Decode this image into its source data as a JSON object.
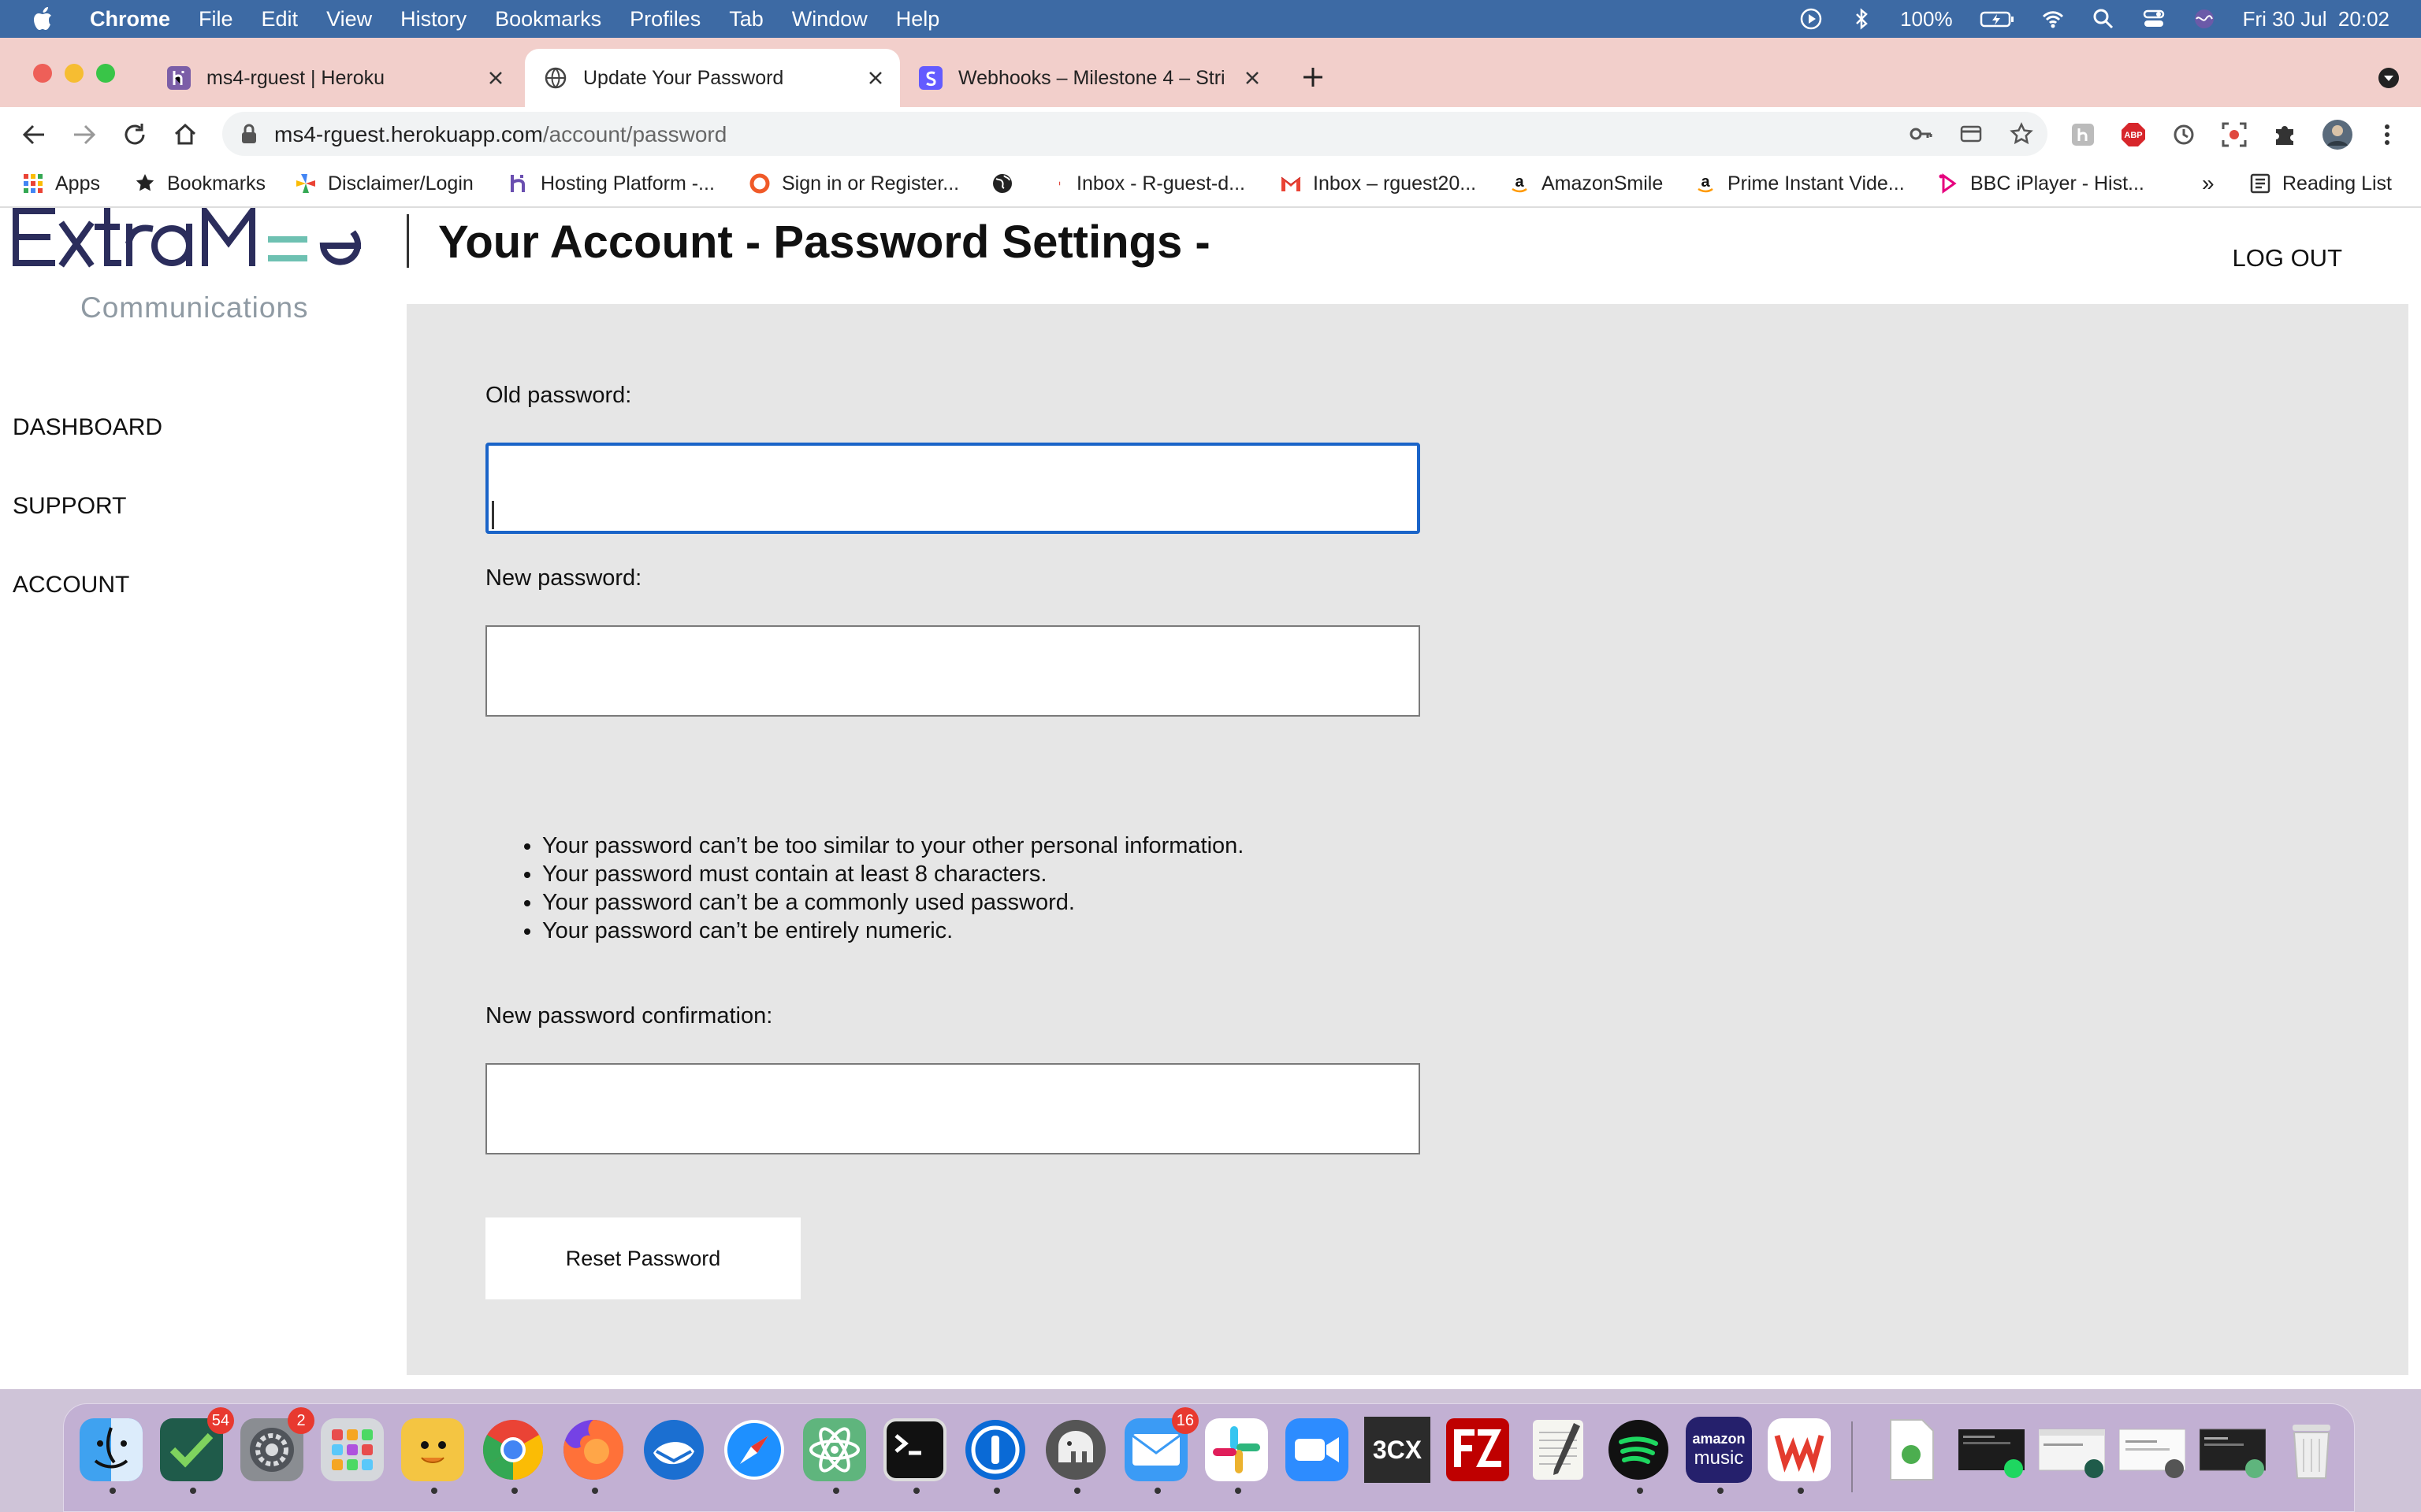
{
  "menubar": {
    "app": "Chrome",
    "items": [
      "File",
      "Edit",
      "View",
      "History",
      "Bookmarks",
      "Profiles",
      "Tab",
      "Window",
      "Help"
    ],
    "battery": "100%",
    "datetime": "Fri 30 Jul  20:02"
  },
  "tabs": [
    {
      "title": "ms4-rguest | Heroku",
      "favicon": "heroku-icon"
    },
    {
      "title": "Update Your Password",
      "favicon": "globe-icon",
      "active": true
    },
    {
      "title": "Webhooks – Milestone 4 – Stri",
      "favicon": "stripe-icon"
    }
  ],
  "toolbar": {
    "url_host": "ms4-rguest.herokuapp.com",
    "url_path": "/account/password"
  },
  "bookmarks": {
    "items": [
      "Apps",
      "Bookmarks",
      "Disclaimer/Login",
      "Hosting Platform -...",
      "Sign in or Register...",
      "",
      "Inbox - R-guest-d...",
      "Inbox – rguest20...",
      "AmazonSmile",
      "Prime Instant Vide...",
      "BBC iPlayer - Hist..."
    ],
    "overflow": "»",
    "reading_list": "Reading List"
  },
  "page": {
    "logo_sub": "Communications",
    "title": "Your Account - Password Settings -",
    "logout": "LOG OUT",
    "nav": [
      "DASHBOARD",
      "SUPPORT",
      "ACCOUNT"
    ]
  },
  "form": {
    "old_label": "Old password:",
    "new_label": "New password:",
    "confirm_label": "New password confirmation:",
    "rules": [
      "Your password can’t be too similar to your other personal information.",
      "Your password must contain at least 8 characters.",
      "Your password can’t be a commonly used password.",
      "Your password can’t be entirely numeric."
    ],
    "submit": "Reset Password"
  },
  "dock": {
    "badges": {
      "tasks": "54",
      "settings": "2",
      "mail": "16"
    },
    "label_3cx": "3CX",
    "label_amazon": "amazon",
    "label_music": "music"
  },
  "colors": {
    "menubar": "#3d6aa4",
    "tabstrip": "#f2cfcb",
    "content_bg": "#e6e6e6",
    "focus_border": "#1a64c8",
    "logo_navy": "#2b2d5c",
    "logo_teal": "#6ec1b2"
  }
}
